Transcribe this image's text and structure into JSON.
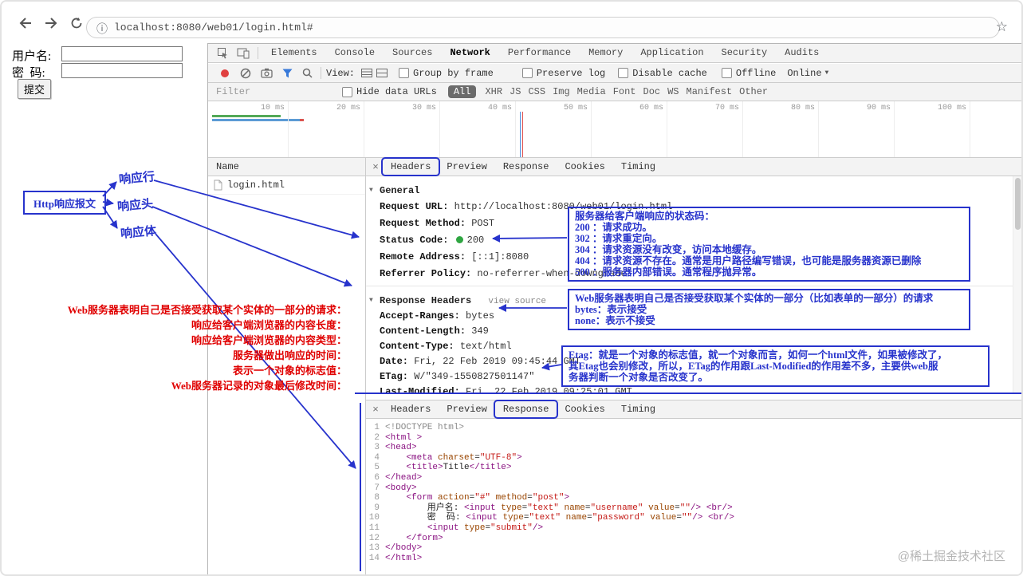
{
  "browser": {
    "url": "localhost:8080/web01/login.html#"
  },
  "page": {
    "username_label": "用户名:",
    "password_label": "密  码:",
    "submit_label": "提交"
  },
  "icons": {
    "close": "×",
    "star": "☆",
    "info": "ⓘ",
    "disclosure": "▼",
    "caret": "▼"
  },
  "colors": {
    "annotation_blue": "#2733cc",
    "annotation_red": "#e00000",
    "status_green": "#2fa642",
    "record_red": "#e04040",
    "filter_blue": "#3879d9"
  },
  "devtools": {
    "tabs": [
      "Elements",
      "Console",
      "Sources",
      "Network",
      "Performance",
      "Memory",
      "Application",
      "Security",
      "Audits"
    ],
    "active_tab": "Network",
    "network_toolbar": {
      "view_label": "View:",
      "checkboxes": [
        "Group by frame",
        "Preserve log",
        "Disable cache",
        "Offline"
      ],
      "throttling": "Online"
    },
    "filter_bar": {
      "placeholder": "Filter",
      "hide_data_urls_label": "Hide data URLs",
      "types": [
        "All",
        "XHR",
        "JS",
        "CSS",
        "Img",
        "Media",
        "Font",
        "Doc",
        "WS",
        "Manifest",
        "Other"
      ],
      "active_type": "All"
    },
    "timeline": {
      "ticks": [
        "10 ms",
        "20 ms",
        "30 ms",
        "40 ms",
        "50 ms",
        "60 ms",
        "70 ms",
        "80 ms",
        "90 ms",
        "100 ms"
      ]
    },
    "requests": {
      "name_header": "Name",
      "rows": [
        "login.html"
      ]
    },
    "detail_tabs": [
      "Headers",
      "Preview",
      "Response",
      "Cookies",
      "Timing"
    ],
    "headers_pane": {
      "annotated_tab": "Headers",
      "general": {
        "title": "General",
        "rows": [
          {
            "key": "Request URL:",
            "value": "http://localhost:8080/web01/login.html"
          },
          {
            "key": "Request Method:",
            "value": "POST"
          },
          {
            "key": "Status Code:",
            "value": "200",
            "dot": true
          },
          {
            "key": "Remote Address:",
            "value": "[::1]:8080"
          },
          {
            "key": "Referrer Policy:",
            "value": "no-referrer-when-downgrade"
          }
        ]
      },
      "response_headers": {
        "title": "Response Headers",
        "view_source": "view source",
        "rows": [
          {
            "key": "Accept-Ranges:",
            "value": "bytes"
          },
          {
            "key": "Content-Length:",
            "value": "349"
          },
          {
            "key": "Content-Type:",
            "value": "text/html"
          },
          {
            "key": "Date:",
            "value": "Fri, 22 Feb 2019 09:45:44 GMT"
          },
          {
            "key": "ETag:",
            "value": "W/\"349-1550827501147\""
          },
          {
            "key": "Last-Modified:",
            "value": "Fri, 22 Feb 2019 09:25:01 GMT"
          }
        ]
      }
    },
    "response_pane": {
      "annotated_tab": "Response",
      "code": [
        [
          [
            "doc",
            "<!DOCTYPE html>"
          ]
        ],
        [
          [
            "tag",
            "<html >"
          ]
        ],
        [
          [
            "tag",
            "<head>"
          ]
        ],
        [
          [
            "pln",
            "    "
          ],
          [
            "tag",
            "<meta "
          ],
          [
            "attr",
            "charset"
          ],
          [
            "pln",
            "="
          ],
          [
            "val",
            "\"UTF-8\""
          ],
          [
            "tag",
            ">"
          ]
        ],
        [
          [
            "pln",
            "    "
          ],
          [
            "tag",
            "<title>"
          ],
          [
            "pln",
            "Title"
          ],
          [
            "tag",
            "</title>"
          ]
        ],
        [
          [
            "tag",
            "</head>"
          ]
        ],
        [
          [
            "tag",
            "<body>"
          ]
        ],
        [
          [
            "pln",
            "    "
          ],
          [
            "tag",
            "<form "
          ],
          [
            "attr",
            "action"
          ],
          [
            "pln",
            "="
          ],
          [
            "val",
            "\"#\""
          ],
          [
            "pln",
            " "
          ],
          [
            "attr",
            "method"
          ],
          [
            "pln",
            "="
          ],
          [
            "val",
            "\"post\""
          ],
          [
            "tag",
            ">"
          ]
        ],
        [
          [
            "pln",
            "        用户名: "
          ],
          [
            "tag",
            "<input "
          ],
          [
            "attr",
            "type"
          ],
          [
            "pln",
            "="
          ],
          [
            "val",
            "\"text\""
          ],
          [
            "pln",
            " "
          ],
          [
            "attr",
            "name"
          ],
          [
            "pln",
            "="
          ],
          [
            "val",
            "\"username\""
          ],
          [
            "pln",
            " "
          ],
          [
            "attr",
            "value"
          ],
          [
            "pln",
            "="
          ],
          [
            "val",
            "\"\""
          ],
          [
            "tag",
            "/>"
          ],
          [
            "pln",
            " "
          ],
          [
            "tag",
            "<br/>"
          ]
        ],
        [
          [
            "pln",
            "        密  码: "
          ],
          [
            "tag",
            "<input "
          ],
          [
            "attr",
            "type"
          ],
          [
            "pln",
            "="
          ],
          [
            "val",
            "\"text\""
          ],
          [
            "pln",
            " "
          ],
          [
            "attr",
            "name"
          ],
          [
            "pln",
            "="
          ],
          [
            "val",
            "\"password\""
          ],
          [
            "pln",
            " "
          ],
          [
            "attr",
            "value"
          ],
          [
            "pln",
            "="
          ],
          [
            "val",
            "\"\""
          ],
          [
            "tag",
            "/>"
          ],
          [
            "pln",
            " "
          ],
          [
            "tag",
            "<br/>"
          ]
        ],
        [
          [
            "pln",
            "        "
          ],
          [
            "tag",
            "<input "
          ],
          [
            "attr",
            "type"
          ],
          [
            "pln",
            "="
          ],
          [
            "val",
            "\"submit\""
          ],
          [
            "tag",
            "/>"
          ]
        ],
        [
          [
            "pln",
            "    "
          ],
          [
            "tag",
            "</form>"
          ]
        ],
        [
          [
            "tag",
            "</body>"
          ]
        ],
        [
          [
            "tag",
            "</html>"
          ]
        ]
      ]
    }
  },
  "annotations": {
    "http_box_label": "Http响应报文",
    "part_labels": [
      "响应行",
      "响应头",
      "响应体"
    ],
    "red_notes": [
      "Web服务器表明自己是否接受获取某个实体的一部分的请求：",
      "响应给客户端浏览器的内容长度：",
      "响应给客户端浏览器的内容类型：",
      "服务器做出响应的时间：",
      "表示一个对象的标志值：",
      "Web服务器记录的对象最后修改时间："
    ],
    "status_note": [
      "服务器给客户端响应的状态码：",
      "200 ：请求成功。",
      "302 ：请求重定向。",
      "304 ：请求资源没有改变，访问本地缓存。",
      "404 ：请求资源不存在。通常是用户路径编写错误，也可能是服务器资源已删除",
      "500 ：服务器内部错误。通常程序抛异常。"
    ],
    "accept_note": [
      "Web服务器表明自己是否接受获取某个实体的一部分（比如表单的一部分）的请求",
      "bytes：表示接受",
      "none：表示不接受"
    ],
    "etag_note": [
      "Etag：就是一个对象的标志值，就一个对象而言，如何一个html文件，如果被修改了，",
      "其Etag也会别修改，所以，ETag的作用跟Last-Modified的作用差不多，主要供web服",
      "务器判断一个对象是否改变了。"
    ]
  },
  "watermark": "@稀土掘金技术社区"
}
